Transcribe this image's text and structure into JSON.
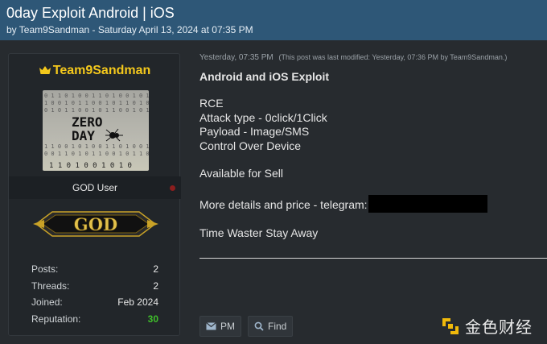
{
  "thread": {
    "title": "0day Exploit Android | iOS",
    "byline": "by Team9Sandman - Saturday April 13, 2024 at 07:35 PM"
  },
  "author": {
    "name": "Team9Sandman",
    "avatar_text_1": "ZERO",
    "avatar_text_2": "DAY",
    "avatar_binary": "1 1 0 1 0 0 1 0 1 0",
    "user_title": "GOD User",
    "rank_badge": "GOD",
    "stats": [
      {
        "label": "Posts:",
        "value": "2"
      },
      {
        "label": "Threads:",
        "value": "2"
      },
      {
        "label": "Joined:",
        "value": "Feb 2024"
      },
      {
        "label": "Reputation:",
        "value": "30"
      }
    ]
  },
  "post": {
    "timestamp": "Yesterday, 07:35 PM",
    "modified_note": "(This post was last modified: Yesterday, 07:36 PM by Team9Sandman.)",
    "heading": "Android and iOS Exploit",
    "line_rce": "RCE",
    "line_attack": "Attack type - 0click/1Click",
    "line_payload": "Payload - Image/SMS",
    "line_control": "Control Over Device",
    "line_sell": "Available for Sell",
    "line_details": "More details and price - telegram:",
    "line_waster": "Time Waster Stay Away"
  },
  "buttons": {
    "pm": "PM",
    "find": "Find"
  },
  "watermark": {
    "text": "金色财经"
  },
  "colors": {
    "header_bg": "#2e5777",
    "username": "#f4c81c",
    "reputation": "#3fbf2a",
    "page_bg": "#272b2f"
  },
  "icons": [
    "crown-icon",
    "envelope-icon",
    "search-icon",
    "logo-icon"
  ]
}
